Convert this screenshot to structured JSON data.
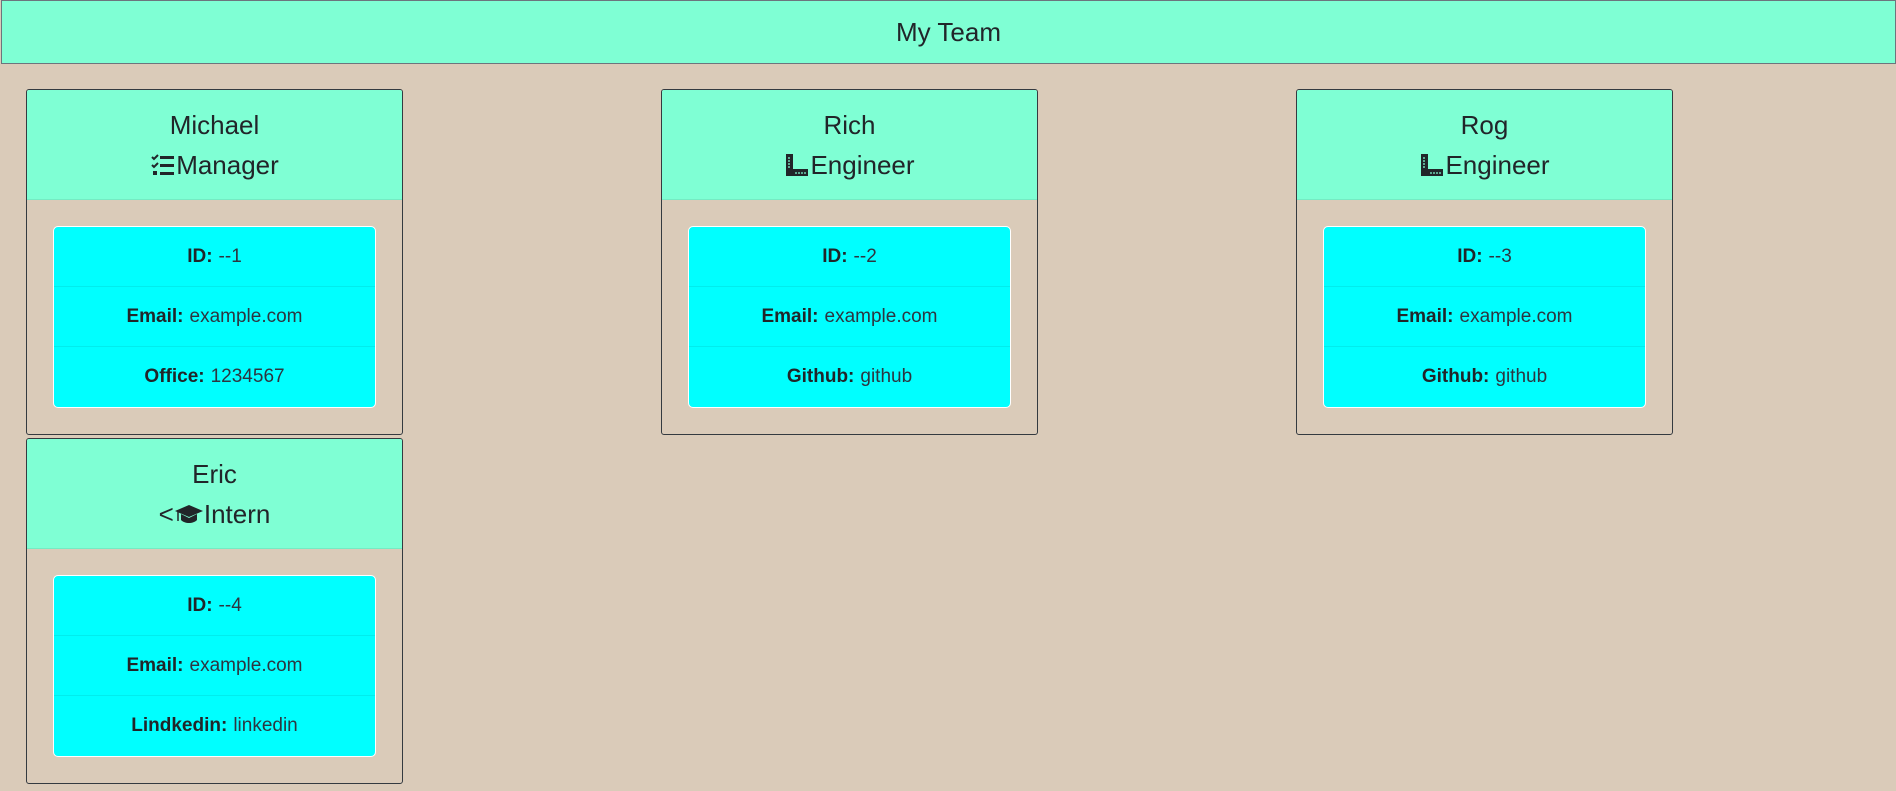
{
  "header": {
    "title": "My Team"
  },
  "colors": {
    "header_bg": "#7fffd4",
    "page_bg": "#dacbb9",
    "list_bg": "#00ffff"
  },
  "cards": [
    {
      "name": "Michael",
      "role_icon": "tasks-icon",
      "role_prefix": "",
      "role": "Manager",
      "fields": [
        {
          "label": "ID:",
          "value": "--1"
        },
        {
          "label": "Email:",
          "value": "example.com"
        },
        {
          "label": "Office:",
          "value": "1234567"
        }
      ]
    },
    {
      "name": "Rich",
      "role_icon": "ruler-combined-icon",
      "role_prefix": "",
      "role": "Engineer",
      "fields": [
        {
          "label": "ID:",
          "value": "--2"
        },
        {
          "label": "Email:",
          "value": "example.com"
        },
        {
          "label": "Github:",
          "value": "github"
        }
      ]
    },
    {
      "name": "Rog",
      "role_icon": "ruler-combined-icon",
      "role_prefix": "",
      "role": "Engineer",
      "fields": [
        {
          "label": "ID:",
          "value": "--3"
        },
        {
          "label": "Email:",
          "value": "example.com"
        },
        {
          "label": "Github:",
          "value": "github"
        }
      ]
    },
    {
      "name": "Eric",
      "role_icon": "graduation-cap-icon",
      "role_prefix": "<",
      "role": "Intern",
      "fields": [
        {
          "label": "ID:",
          "value": "--4"
        },
        {
          "label": "Email:",
          "value": "example.com"
        },
        {
          "label": "Lindkedin:",
          "value": "linkedin"
        }
      ]
    }
  ]
}
